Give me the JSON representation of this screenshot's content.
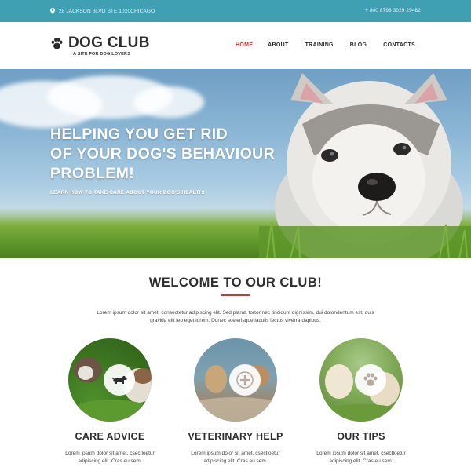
{
  "topbar": {
    "address": "28 JACKSON BLVD STE 1020CHICAGO",
    "phone": "+ 800 8798 3029 29482"
  },
  "header": {
    "logo_title": "DOG CLUB",
    "logo_tagline": "A SITE FOR DOG LOVERS",
    "nav": [
      "HOME",
      "ABOUT",
      "TRAINING",
      "BLOG",
      "CONTACTS"
    ],
    "active_nav": "HOME"
  },
  "hero": {
    "heading_lines": [
      "HELPING YOU GET RID",
      "OF YOUR DOG'S BEHAVIOUR",
      "PROBLEM!"
    ],
    "subheading": "LEARN HOW TO TAKE CARE ABOUT YOUR DOG'S HEALTH!"
  },
  "welcome": {
    "title": "WELCOME TO OUR CLUB!",
    "text": "Lorem ipsum dolor sit amet, consectetur adipiscing elit. Sed plarat, tortor nec tincidunt dignissim, dui dolondentum est, quis gravida elit leo eget lorem. Donec scelerisque iaculis lectus viverra dapibus."
  },
  "features": [
    {
      "title": "CARE ADVICE",
      "icon": "dog-icon",
      "text": "Lorem ipsum dolor sit amet, csectloetur adipiscing elit. Cras eu sem."
    },
    {
      "title": "VETERINARY HELP",
      "icon": "plus-icon",
      "text": "Lorem ipsum dolor sit amet, csectloetur adipiscing elit. Cras eu sem."
    },
    {
      "title": "OUR TIPS",
      "icon": "paw-icon",
      "text": "Lorem ipsum dolor sit amet, csectloetur adipiscing elit. Cras eu sem."
    }
  ],
  "colors": {
    "topbar": "#3f9fb3",
    "accent": "#b4413a",
    "heading": "#2e2e2e"
  }
}
